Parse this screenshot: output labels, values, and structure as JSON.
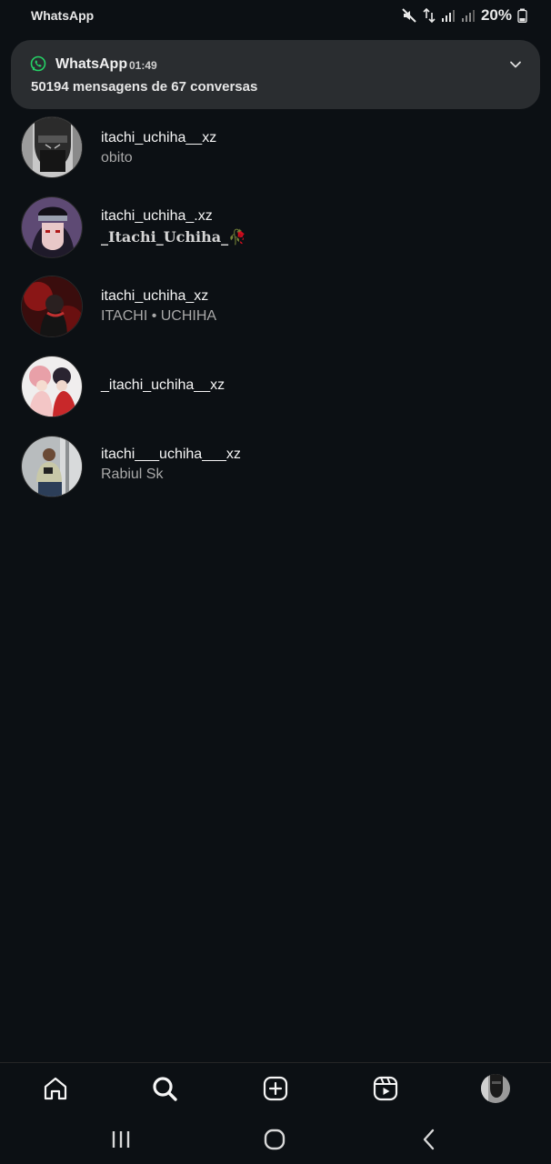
{
  "status_bar": {
    "app_label": "WhatsApp",
    "battery": "20%",
    "icons": [
      "mute-icon",
      "data-arrows-icon",
      "signal-icon",
      "signal-icon",
      "battery-icon"
    ]
  },
  "notification": {
    "app": "WhatsApp",
    "time": "01:49",
    "text": "50194 mensagens de 67 conversas",
    "accent": "#25d366"
  },
  "results": [
    {
      "username": "itachi_uchiha__xz",
      "subtitle": "obito"
    },
    {
      "username": "itachi_uchiha_.xz",
      "subtitle": "_𝐈𝐭𝐚𝐜𝐡𝐢_𝐔𝐜𝐡𝐢𝐡𝐚_🥀"
    },
    {
      "username": "itachi_uchiha_xz",
      "subtitle": "ITACHI  • UCHIHA"
    },
    {
      "username": "_itachi_uchiha__xz",
      "subtitle": ""
    },
    {
      "username": "itachi___uchiha___xz",
      "subtitle": "Rabiul Sk"
    }
  ],
  "bottom_nav": [
    "home-icon",
    "search-icon",
    "create-icon",
    "reels-icon",
    "profile-avatar"
  ],
  "system_nav": [
    "recents-icon",
    "home-circle-icon",
    "back-icon"
  ],
  "colors": {
    "background": "#0c1014",
    "notification_bg": "#2a2d30",
    "secondary_text": "#a8a8a8"
  }
}
